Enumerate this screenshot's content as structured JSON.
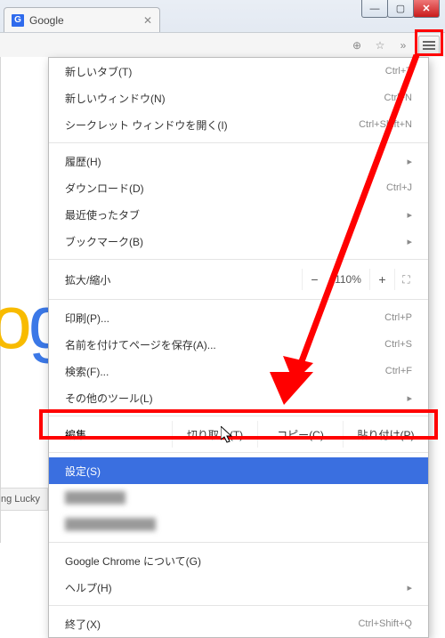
{
  "window": {
    "minimize": "—",
    "maximize": "▢",
    "close": "✕"
  },
  "tab": {
    "title": "Google",
    "favicon_letter": "G",
    "close": "✕"
  },
  "toolbar": {
    "zoom_icon": "⊕",
    "star_icon": "☆",
    "chevron": "»"
  },
  "menu": {
    "new_tab": "新しいタブ(T)",
    "new_tab_accel": "Ctrl+T",
    "new_window": "新しいウィンドウ(N)",
    "new_window_accel": "Ctrl+N",
    "incognito": "シークレット ウィンドウを開く(I)",
    "incognito_accel": "Ctrl+Shift+N",
    "history": "履歴(H)",
    "history_sub": "▸",
    "downloads": "ダウンロード(D)",
    "downloads_accel": "Ctrl+J",
    "recent_tabs": "最近使ったタブ",
    "recent_tabs_sub": "▸",
    "bookmarks": "ブックマーク(B)",
    "bookmarks_sub": "▸",
    "zoom_label": "拡大/縮小",
    "zoom_minus": "−",
    "zoom_value": "110%",
    "zoom_plus": "+",
    "fullscreen": "⛶",
    "print": "印刷(P)...",
    "print_accel": "Ctrl+P",
    "save_as": "名前を付けてページを保存(A)...",
    "save_as_accel": "Ctrl+S",
    "find": "検索(F)...",
    "find_accel": "Ctrl+F",
    "more_tools": "その他のツール(L)",
    "more_tools_sub": "▸",
    "edit_label": "編集",
    "cut": "切り取り(T)",
    "copy": "コピー(C)",
    "paste": "貼り付け(P)",
    "settings": "設定(S)",
    "hidden1": "████████",
    "hidden2": "████████████",
    "about": "Google Chrome について(G)",
    "help": "ヘルプ(H)",
    "help_sub": "▸",
    "exit": "終了(X)",
    "exit_accel": "Ctrl+Shift+Q"
  },
  "page": {
    "lucky": "ng Lucky"
  }
}
